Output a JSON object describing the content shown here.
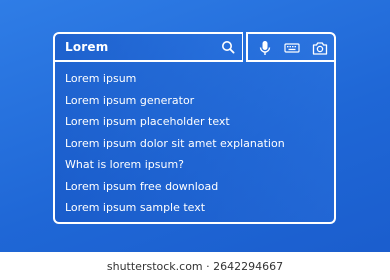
{
  "search": {
    "query": "Lorem"
  },
  "icons": {
    "search": "search-icon",
    "mic": "microphone-icon",
    "keyboard": "keyboard-icon",
    "camera": "camera-icon"
  },
  "suggestions": [
    "Lorem ipsum",
    "Lorem ipsum generator",
    "Lorem ipsum placeholder text",
    "Lorem ipsum dolor sit amet explanation",
    "What is lorem ipsum?",
    "Lorem ipsum free download",
    "Lorem ipsum sample text"
  ],
  "watermark": {
    "text": "shutterstock.com · 2642294667"
  },
  "colors": {
    "background": "#1f67d6",
    "foreground": "#ffffff"
  }
}
